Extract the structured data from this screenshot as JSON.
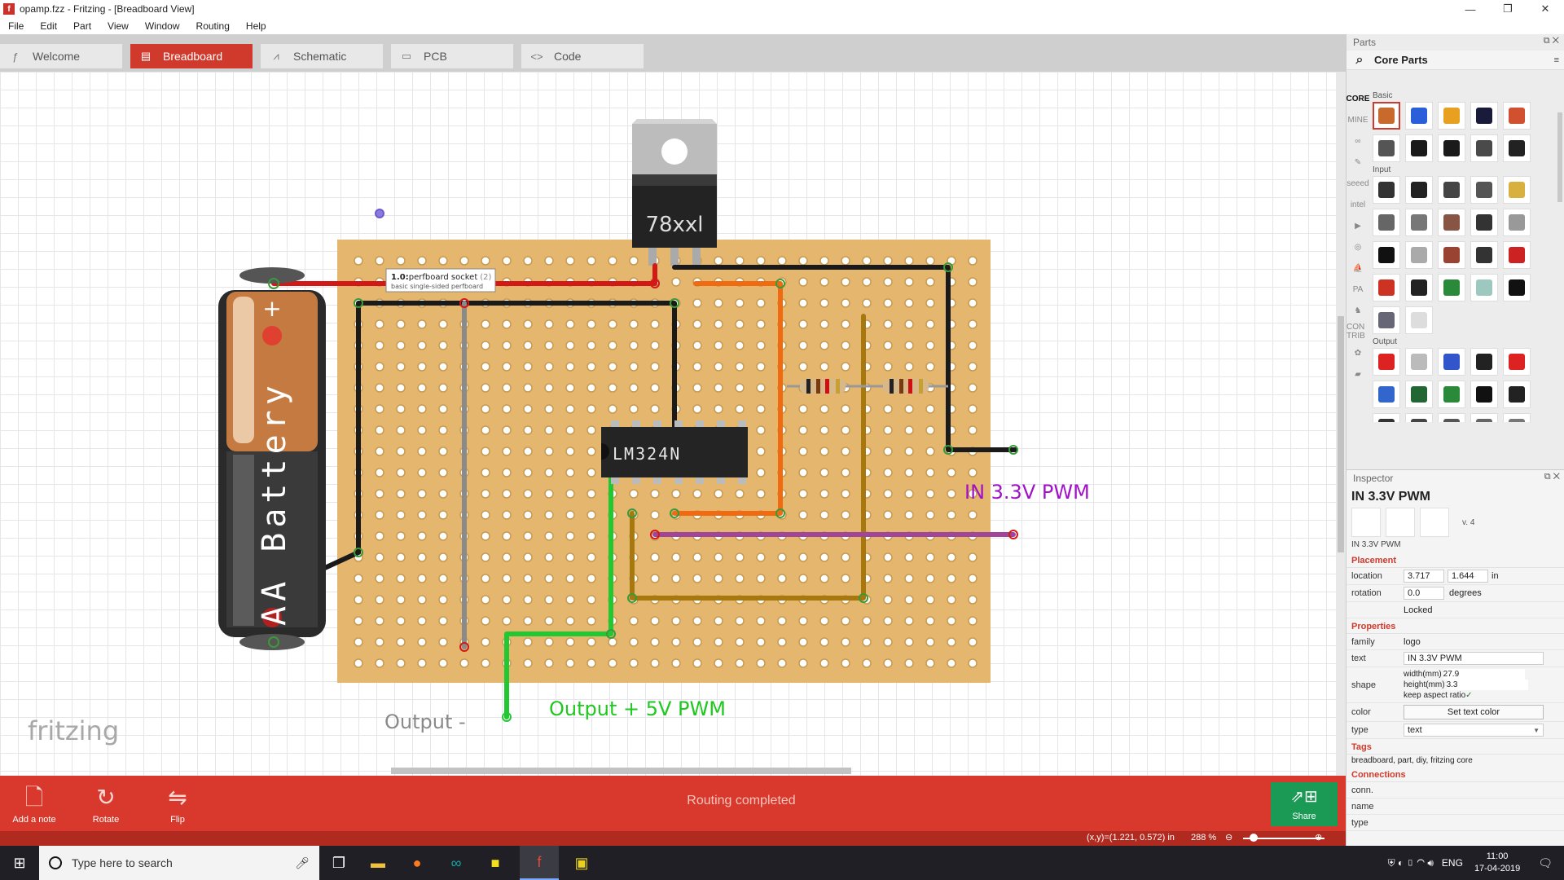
{
  "window": {
    "title": "opamp.fzz - Fritzing - [Breadboard View]",
    "app_icon_letter": "f",
    "minimize": "—",
    "maximize": "❐",
    "close": "✕"
  },
  "menu": [
    "File",
    "Edit",
    "Part",
    "View",
    "Window",
    "Routing",
    "Help"
  ],
  "tabs": [
    {
      "label": "Welcome",
      "icon": "ƒ",
      "active": false
    },
    {
      "label": "Breadboard",
      "icon": "▤",
      "active": true
    },
    {
      "label": "Schematic",
      "icon": "⩘",
      "active": false
    },
    {
      "label": "PCB",
      "icon": "▭",
      "active": false
    },
    {
      "label": "Code",
      "icon": "<>",
      "active": false
    }
  ],
  "canvas": {
    "regulator_label": "78xxl",
    "ic_label": "LM324N",
    "battery_label": "AA Battery",
    "battery_plus": "+",
    "battery_minus": "-",
    "tooltip_title": "1.0:",
    "tooltip_name": "perfboard socket",
    "tooltip_count": "(2)",
    "tooltip_desc": "basic single-sided perfboard",
    "label_in": "IN 3.3V PWM",
    "label_out_minus": "Output -",
    "label_out_plus": "Output + 5V PWM",
    "watermark": "fritzing",
    "wire_colors": {
      "red": "#d31818",
      "black": "#1a1a1a",
      "orange": "#ef6a10",
      "green": "#22c832",
      "gray": "#8a8a8a",
      "brown": "#a6780e",
      "purple": "#a0459a"
    },
    "board_color": "#e4b66e",
    "in_label_color": "#a012c8",
    "out_plus_color": "#1ec81e",
    "out_minus_color": "#8a8a8a"
  },
  "toolbar": {
    "add_note": "Add a note",
    "rotate": "Rotate",
    "flip": "Flip",
    "status": "Routing completed",
    "share": "Share"
  },
  "statusbar": {
    "coords": "(x,y)=(1.221, 0.572) in",
    "zoom": "288 %",
    "zoom_out": "⊖",
    "zoom_in": "⊕"
  },
  "parts": {
    "panel_title": "Parts",
    "bin_title": "Core Parts",
    "bins": [
      "CORE",
      "MINE",
      "∞",
      "✎",
      "seeed",
      "intel",
      "▶",
      "◎",
      "⛵",
      "PA",
      "♞",
      "CON TRIB",
      "✿",
      "▰"
    ],
    "categories": [
      {
        "name": "Basic",
        "items": [
          "#c86a2e",
          "#2b5fd9",
          "#e8a020",
          "#1a1a3a",
          "#d05030",
          "#555555",
          "#1a1a1a",
          "#1a1a1a",
          "#4a4a4a",
          "#222222"
        ]
      },
      {
        "name": "Input",
        "items": [
          "#333333",
          "#222222",
          "#444444",
          "#555555",
          "#d8b040",
          "#666666",
          "#777777",
          "#885544",
          "#333333",
          "#999999",
          "#111111",
          "#aaaaaa",
          "#994433",
          "#333333",
          "#cc2222",
          "#cc3322",
          "#222222",
          "#2a8a3a",
          "#9cc8c0",
          "#111111",
          "#666677",
          "#dddddd"
        ]
      },
      {
        "name": "Output",
        "items": [
          "#dd2222",
          "#bbbbbb",
          "#3355cc",
          "#222222",
          "#dd2222",
          "#3366cc",
          "#226633",
          "#2a8a3a",
          "#111111",
          "#222222",
          "#333333",
          "#444444",
          "#555555",
          "#666666",
          "#777777"
        ]
      }
    ]
  },
  "inspector": {
    "panel_title": "Inspector",
    "title": "IN 3.3V PWM",
    "version": "v. 4",
    "subtitle": "IN 3.3V PWM",
    "placement_head": "Placement",
    "location_label": "location",
    "location_x": "3.717",
    "location_y": "1.644",
    "location_unit": "in",
    "rotation_label": "rotation",
    "rotation_value": "0.0",
    "rotation_unit": "degrees",
    "locked_label": "Locked",
    "properties_head": "Properties",
    "family_label": "family",
    "family_value": "logo",
    "text_label": "text",
    "text_value": "IN 3.3V PWM",
    "shape_label": "shape",
    "width_text": "width(mm)",
    "width_value": "27.9",
    "height_text": "height(mm)",
    "height_value": "3.3",
    "keep_aspect": "keep aspect ratio",
    "keep_aspect_check": "✓",
    "color_label": "color",
    "color_button": "Set text color",
    "type_label": "type",
    "type_value": "text",
    "tags_head": "Tags",
    "tags_value": "breadboard, part, diy, fritzing core",
    "connections_head": "Connections",
    "conn_label": "conn.",
    "name_label": "name",
    "type2_label": "type"
  },
  "taskbar": {
    "search_placeholder": "Type here to search",
    "lang": "ENG",
    "time": "11:00",
    "date": "17-04-2019"
  }
}
